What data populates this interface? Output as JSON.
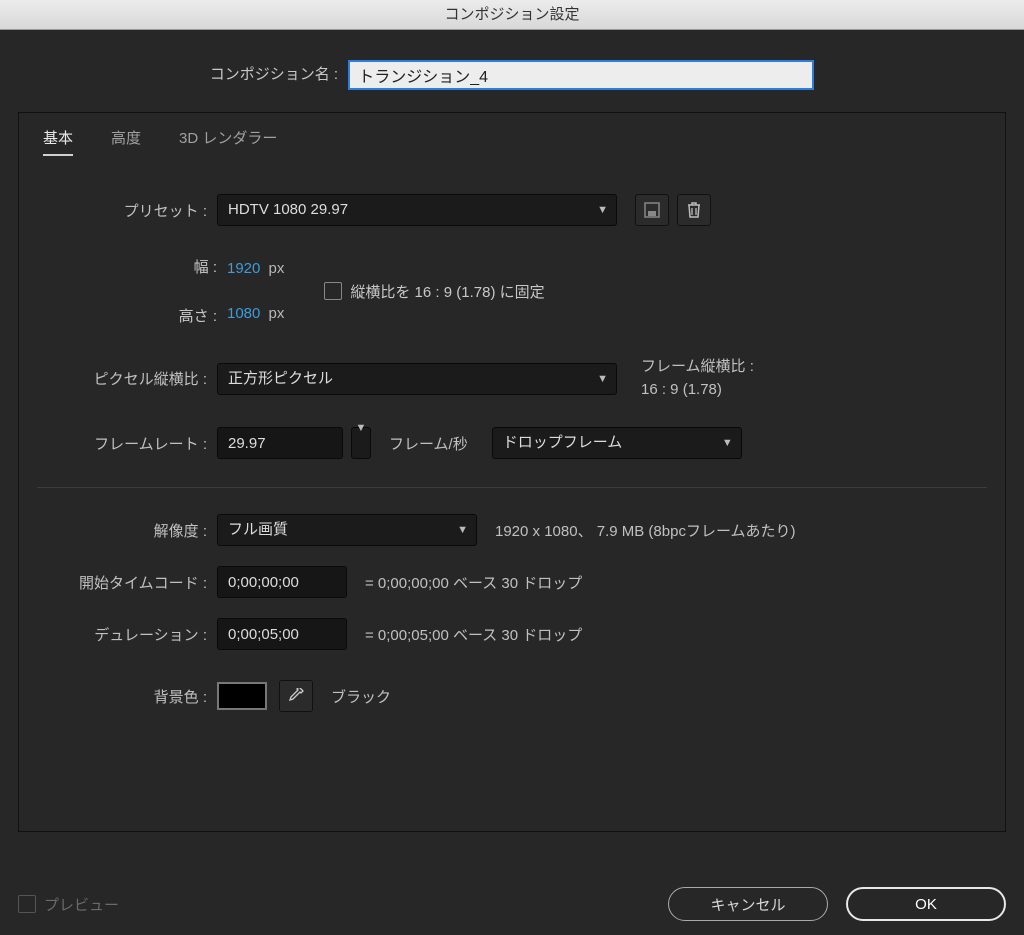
{
  "dialog": {
    "title": "コンポジション設定",
    "name_label": "コンポジション名 :",
    "name_value": "トランジション_4"
  },
  "tabs": {
    "basic": "基本",
    "advanced": "高度",
    "renderer": "3D レンダラー"
  },
  "preset": {
    "label": "プリセット :",
    "value": "HDTV 1080 29.97"
  },
  "dimensions": {
    "width_label": "幅 :",
    "width_value": "1920",
    "height_label": "高さ :",
    "height_value": "1080",
    "unit": "px",
    "lock_label": "縦横比を 16 : 9 (1.78) に固定"
  },
  "pixel_aspect": {
    "label": "ピクセル縦横比 :",
    "value": "正方形ピクセル",
    "frame_ratio_label": "フレーム縦横比 :",
    "frame_ratio_value": "16 : 9 (1.78)"
  },
  "framerate": {
    "label": "フレームレート :",
    "value": "29.97",
    "fps_label": "フレーム/秒",
    "drop_value": "ドロップフレーム"
  },
  "resolution": {
    "label": "解像度 :",
    "value": "フル画質",
    "info": "1920 x 1080、 7.9 MB (8bpcフレームあたり)"
  },
  "timecode": {
    "start_label": "開始タイムコード :",
    "start_value": "0;00;00;00",
    "start_info": "= 0;00;00;00  ベース 30  ドロップ",
    "duration_label": "デュレーション :",
    "duration_value": "0;00;05;00",
    "duration_info": "= 0;00;05;00  ベース 30  ドロップ"
  },
  "bgcolor": {
    "label": "背景色 :",
    "name": "ブラック",
    "value": "#000000"
  },
  "footer": {
    "preview": "プレビュー",
    "cancel": "キャンセル",
    "ok": "OK"
  }
}
